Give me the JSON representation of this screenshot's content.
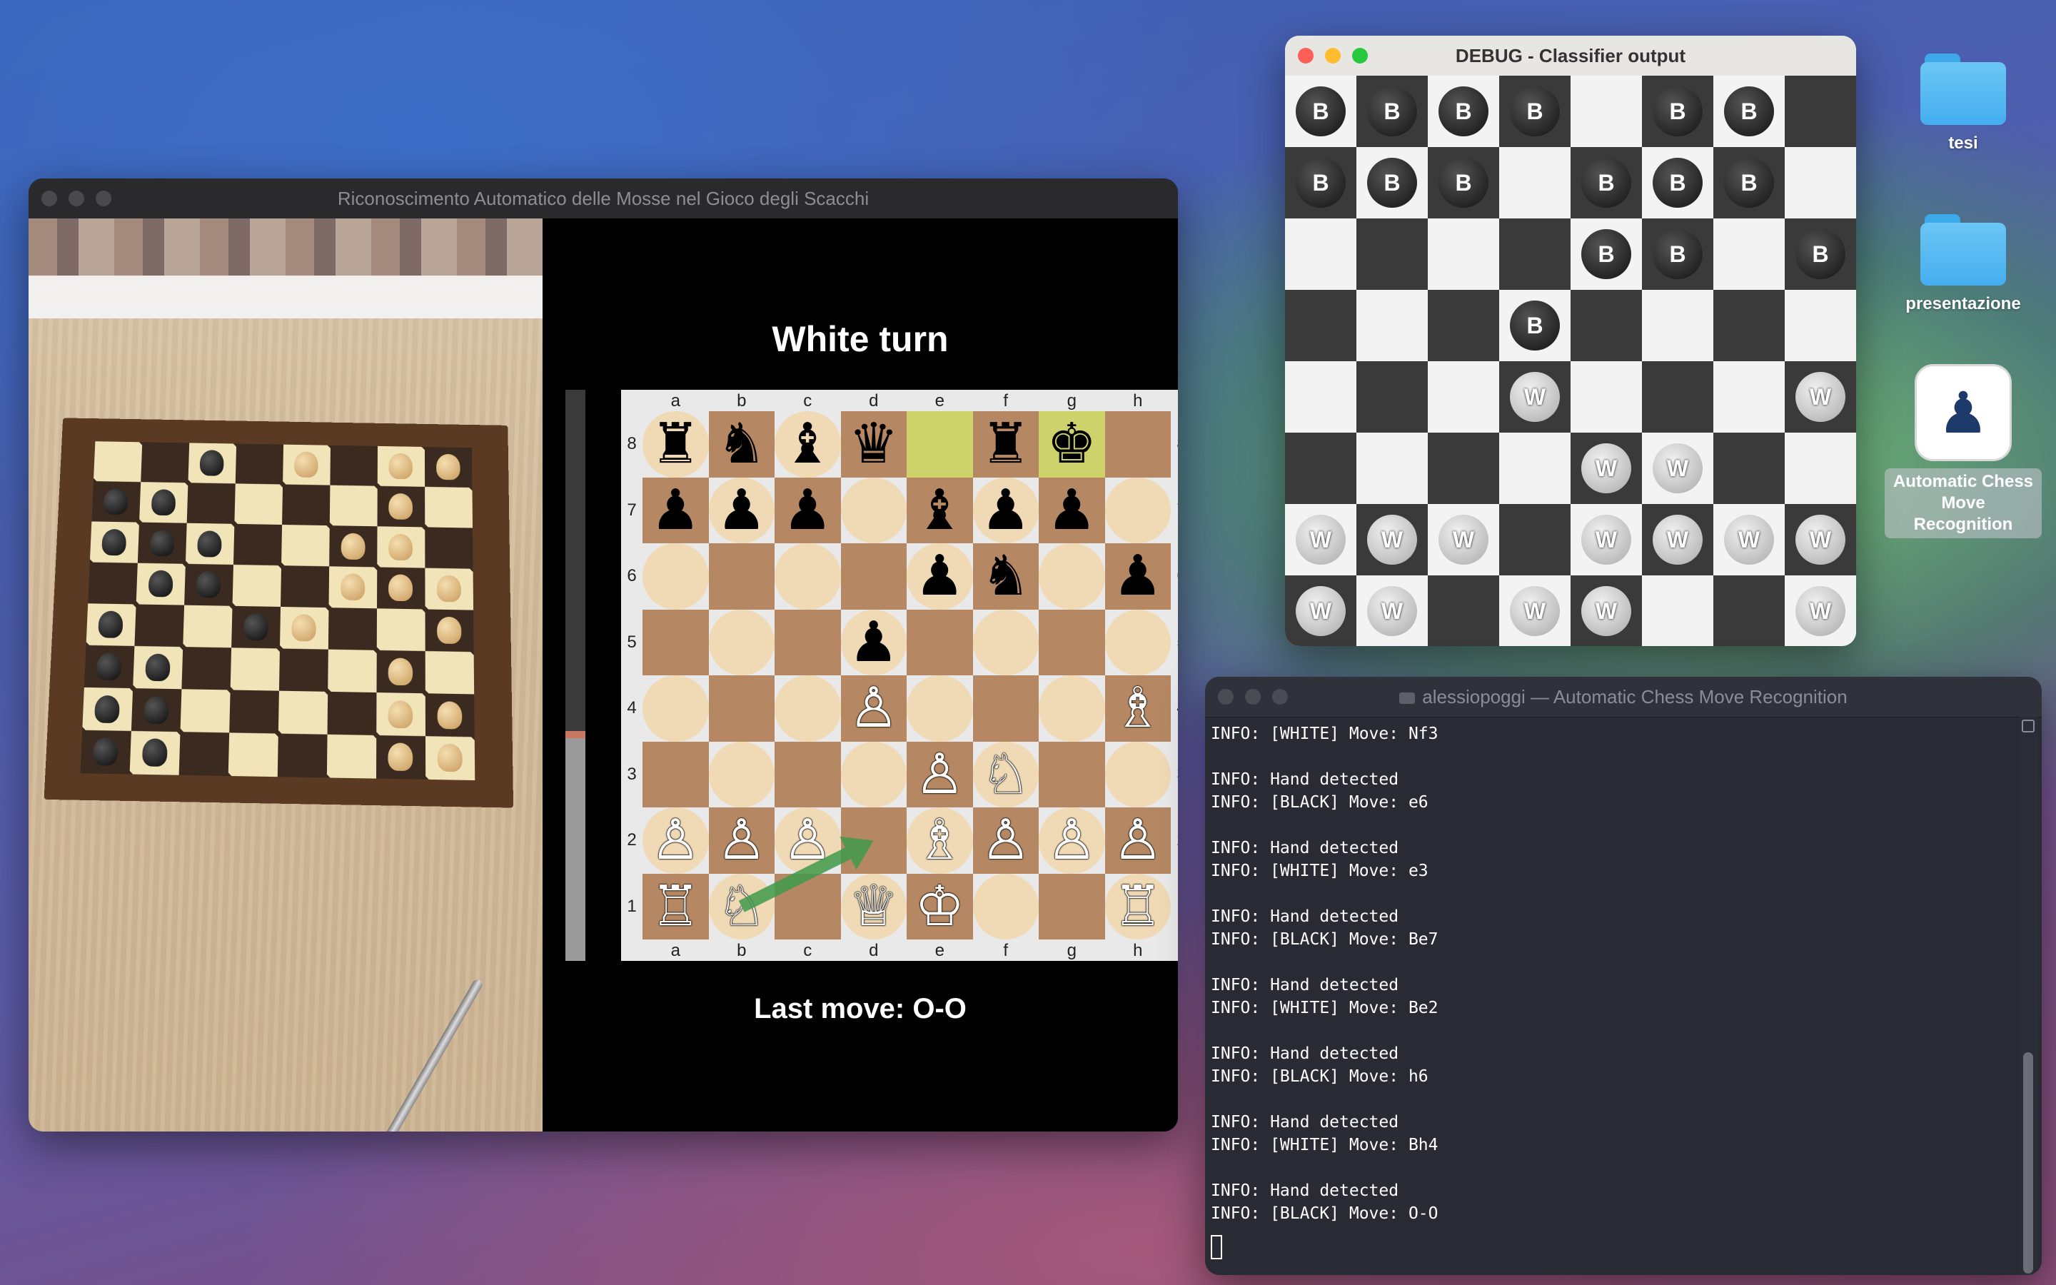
{
  "main_window": {
    "title": "Riconoscimento Automatico delle Mosse nel Gioco degli Scacchi",
    "turn_label": "White turn",
    "last_move_label": "Last move: O-O",
    "files": [
      "a",
      "b",
      "c",
      "d",
      "e",
      "f",
      "g",
      "h"
    ],
    "ranks": [
      "8",
      "7",
      "6",
      "5",
      "4",
      "3",
      "2",
      "1"
    ],
    "board": [
      [
        "♜",
        "♞",
        "♝",
        "♛",
        "",
        "♜",
        "♚",
        ""
      ],
      [
        "♟",
        "♟",
        "♟",
        "",
        "♝",
        "♟",
        "♟",
        ""
      ],
      [
        "",
        "",
        "",
        "",
        "♟",
        "♞",
        "",
        "♟"
      ],
      [
        "",
        "",
        "",
        "♟",
        "",
        "",
        "",
        ""
      ],
      [
        "",
        "",
        "",
        "♙",
        "",
        "",
        "",
        "♗"
      ],
      [
        "",
        "",
        "",
        "",
        "♙",
        "♘",
        "",
        ""
      ],
      [
        "♙",
        "♙",
        "♙",
        "",
        "♗",
        "♙",
        "♙",
        "♙"
      ],
      [
        "♖",
        "♘",
        "",
        "♕",
        "♔",
        "",
        "",
        "♖"
      ]
    ],
    "highlight_squares": [
      "e8",
      "g8"
    ],
    "arrow": {
      "from": "b1",
      "to": "d2",
      "color": "#3f9a4c"
    },
    "eval_white_fraction": 0.39
  },
  "debug_window": {
    "title": "DEBUG - Classifier output",
    "cells": [
      [
        "B",
        "B",
        "B",
        "B",
        "",
        "B",
        "B",
        ""
      ],
      [
        "B",
        "B",
        "B",
        "",
        "B",
        "B",
        "B",
        ""
      ],
      [
        "",
        "",
        "",
        "",
        "B",
        "B",
        "",
        "B"
      ],
      [
        "",
        "",
        "",
        "B",
        "",
        "",
        "",
        ""
      ],
      [
        "",
        "",
        "",
        "W",
        "",
        "",
        "",
        "W"
      ],
      [
        "",
        "",
        "",
        "",
        "W",
        "W",
        "",
        ""
      ],
      [
        "W",
        "W",
        "W",
        "",
        "W",
        "W",
        "W",
        "W"
      ],
      [
        "W",
        "W",
        "",
        "W",
        "W",
        "",
        "",
        "W"
      ]
    ]
  },
  "terminal_window": {
    "title": "alessiopoggi — Automatic Chess Move Recognition",
    "lines": [
      "INFO: [WHITE] Move: Nf3",
      "",
      "INFO: Hand detected",
      "INFO: [BLACK] Move: e6",
      "",
      "INFO: Hand detected",
      "INFO: [WHITE] Move: e3",
      "",
      "INFO: Hand detected",
      "INFO: [BLACK] Move: Be7",
      "",
      "INFO: Hand detected",
      "INFO: [WHITE] Move: Be2",
      "",
      "INFO: Hand detected",
      "INFO: [BLACK] Move: h6",
      "",
      "INFO: Hand detected",
      "INFO: [WHITE] Move: Bh4",
      "",
      "INFO: Hand detected",
      "INFO: [BLACK] Move: O-O"
    ]
  },
  "desktop": {
    "icons": [
      {
        "label": "tesi",
        "type": "folder"
      },
      {
        "label": "presentazione",
        "type": "folder"
      },
      {
        "label": "Automatic Chess\nMove Recognition",
        "type": "app",
        "glyph": "♟"
      }
    ]
  },
  "colors": {
    "light_square": "#f0d9b5",
    "dark_square": "#b58863",
    "highlight": "#ced26b",
    "traffic_red": "#fe5f57",
    "traffic_yellow": "#febc2e",
    "traffic_green": "#28c840",
    "inactive_light": "#4a4a4d"
  }
}
